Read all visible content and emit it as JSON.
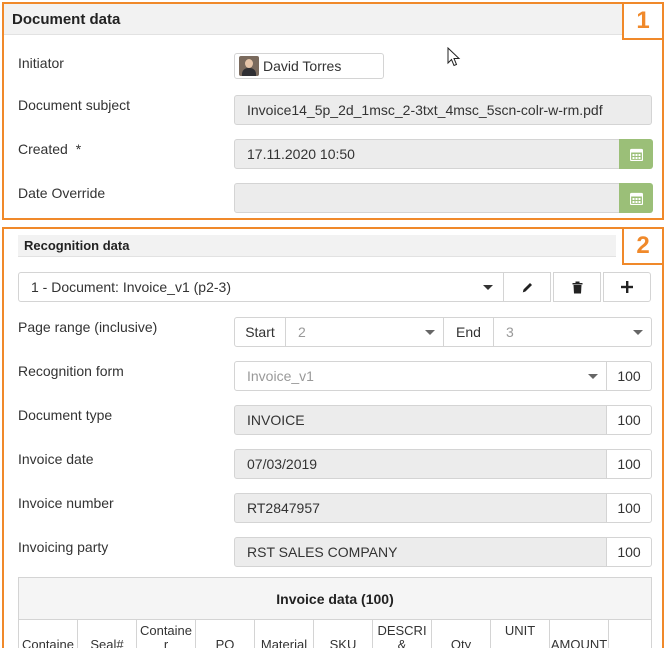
{
  "document_panel": {
    "title": "Document data",
    "badge": "1",
    "initiator_label": "Initiator",
    "initiator_value": "David Torres",
    "subject_label": "Document subject",
    "subject_value": "Invoice14_5p_2d_1msc_2-3txt_4msc_5scn-colr-w-rm.pdf",
    "created_label": "Created",
    "created_required": "*",
    "created_value": "17.11.2020 10:50",
    "override_label": "Date Override",
    "override_value": ""
  },
  "recognition_panel": {
    "title": "Recognition data",
    "badge": "2",
    "document_select": "1 - Document: Invoice_v1 (p2-3)",
    "page_range_label": "Page range (inclusive)",
    "start_label": "Start",
    "start_value": "2",
    "end_label": "End",
    "end_value": "3",
    "form_label": "Recognition form",
    "form_value": "Invoice_v1",
    "form_score": "100",
    "fields": [
      {
        "label": "Document type",
        "value": "INVOICE",
        "score": "100"
      },
      {
        "label": "Invoice date",
        "value": "07/03/2019",
        "score": "100"
      },
      {
        "label": "Invoice number",
        "value": "RT2847957",
        "score": "100"
      },
      {
        "label": "Invoicing party",
        "value": "RST SALES COMPANY",
        "score": "100"
      }
    ],
    "table": {
      "title": "Invoice data (100)",
      "columns": [
        "Containe",
        "Seal#",
        "Containe r",
        "PO",
        "Material",
        "SKU",
        "DESCRI &",
        "Qty",
        "UNIT",
        "AMOUNT",
        ""
      ]
    }
  },
  "colors": {
    "accent": "#f0892a",
    "calendar_button": "#9bbf78"
  },
  "icons": {
    "calendar": "calendar-icon",
    "edit": "pencil-icon",
    "delete": "trash-icon",
    "add": "plus-icon"
  }
}
